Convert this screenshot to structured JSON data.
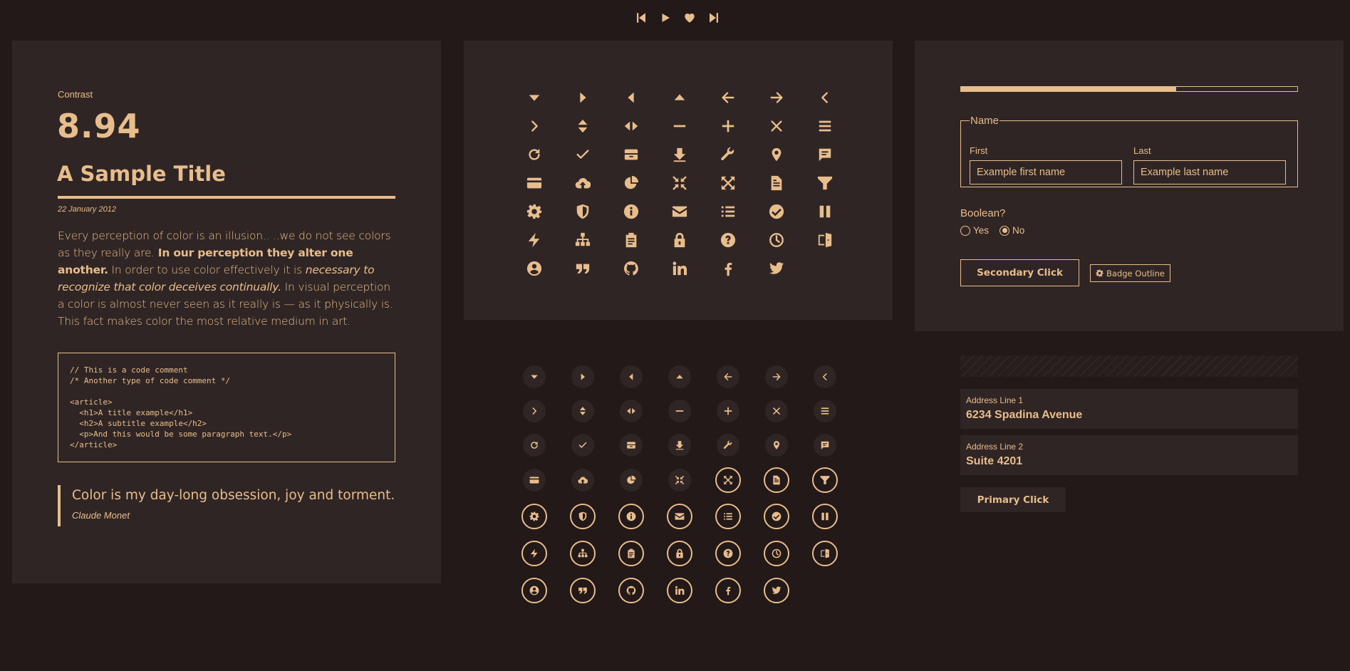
{
  "colors": {
    "background": "#221918",
    "panel": "#2f2524",
    "accent": "#e8bd8c"
  },
  "player": {
    "controls": [
      {
        "name": "skip-previous-icon"
      },
      {
        "name": "play-icon"
      },
      {
        "name": "heart-icon"
      },
      {
        "name": "skip-next-icon"
      }
    ]
  },
  "typography": {
    "contrast_label": "Contrast",
    "contrast_value": "8.94",
    "title": "A Sample Title",
    "date": "22 January 2012",
    "paragraph": {
      "part1": "Every perception of color is an illusion.. ..we do not see colors as they really are. ",
      "bold": "In our perception they alter one another.",
      "part2": " In order to use color effectively it is ",
      "italic": "necessary to recognize that color deceives continually.",
      "part3": " In visual perception a color is almost never seen as it really is — as it physically is. This fact makes color the most relative medium in art."
    },
    "code": "// This is a code comment\n/* Another type of code comment */\n\n<article>\n  <h1>A title example</h1>\n  <h2>A subtitle example</h2>\n  <p>And this would be some paragraph text.</p>\n</article>",
    "quote": {
      "text": "Color is my day-long obsession, joy and torment.",
      "cite": "Claude Monet"
    }
  },
  "icons": [
    "caret-down-icon",
    "caret-right-icon",
    "caret-left-icon",
    "caret-up-icon",
    "arrow-left-icon",
    "arrow-right-icon",
    "chevron-left-icon",
    "chevron-right-icon",
    "sort-vertical-icon",
    "sort-horizontal-icon",
    "minus-icon",
    "plus-icon",
    "close-icon",
    "menu-icon",
    "refresh-icon",
    "check-icon",
    "archive-icon",
    "download-icon",
    "wrench-icon",
    "location-pin-icon",
    "comment-icon",
    "credit-card-icon",
    "cloud-upload-icon",
    "pie-chart-icon",
    "collapse-icon",
    "expand-icon",
    "document-icon",
    "filter-icon",
    "gear-icon",
    "shield-icon",
    "info-icon",
    "mail-icon",
    "list-icon",
    "check-circle-icon",
    "pause-icon",
    "lightning-icon",
    "sitemap-icon",
    "clipboard-icon",
    "lock-icon",
    "question-icon",
    "clock-icon",
    "door-exit-icon",
    "user-circle-icon",
    "quote-icon",
    "github-icon",
    "linkedin-icon",
    "facebook-icon",
    "twitter-icon"
  ],
  "form": {
    "progress_fraction": 0.64,
    "fieldset_legend": "Name",
    "first_label": "First",
    "first_placeholder": "Example first name",
    "last_label": "Last",
    "last_placeholder": "Example last name",
    "boolean_label": "Boolean?",
    "radio_yes": "Yes",
    "radio_no": "No",
    "radio_selected": "No",
    "secondary_button": "Secondary Click",
    "badge_label": "Badge Outline",
    "badge_icon": "gear-icon"
  },
  "address": {
    "line1_label": "Address Line 1",
    "line1_value": "6234 Spadina Avenue",
    "line2_label": "Address Line 2",
    "line2_value": "Suite 4201",
    "primary_button": "Primary Click"
  }
}
